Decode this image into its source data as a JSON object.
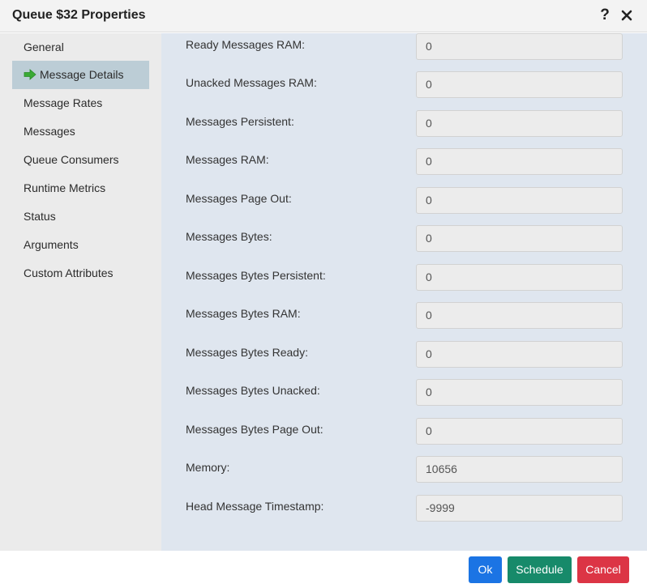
{
  "window": {
    "title": "Queue $32 Properties",
    "help_icon": "help-icon",
    "close_icon": "close-icon"
  },
  "sidebar": {
    "items": [
      {
        "label": "General",
        "active": false
      },
      {
        "label": "Message Details",
        "active": true,
        "icon": "arrow-right-icon"
      },
      {
        "label": "Message Rates",
        "active": false
      },
      {
        "label": "Messages",
        "active": false
      },
      {
        "label": "Queue Consumers",
        "active": false
      },
      {
        "label": "Runtime Metrics",
        "active": false
      },
      {
        "label": "Status",
        "active": false
      },
      {
        "label": "Arguments",
        "active": false
      },
      {
        "label": "Custom Attributes",
        "active": false
      }
    ]
  },
  "fields": [
    {
      "label": "Ready Messages RAM:",
      "value": "0"
    },
    {
      "label": "Unacked Messages RAM:",
      "value": "0"
    },
    {
      "label": "Messages Persistent:",
      "value": "0"
    },
    {
      "label": "Messages RAM:",
      "value": "0"
    },
    {
      "label": "Messages Page Out:",
      "value": "0"
    },
    {
      "label": "Messages Bytes:",
      "value": "0"
    },
    {
      "label": "Messages Bytes Persistent:",
      "value": "0"
    },
    {
      "label": "Messages Bytes RAM:",
      "value": "0"
    },
    {
      "label": "Messages Bytes Ready:",
      "value": "0"
    },
    {
      "label": "Messages Bytes Unacked:",
      "value": "0"
    },
    {
      "label": "Messages Bytes Page Out:",
      "value": "0"
    },
    {
      "label": "Memory:",
      "value": "10656"
    },
    {
      "label": "Head Message Timestamp:",
      "value": "-9999"
    }
  ],
  "footer": {
    "ok_label": "Ok",
    "schedule_label": "Schedule",
    "cancel_label": "Cancel"
  },
  "colors": {
    "ok": "#1b74e4",
    "schedule": "#178a6a",
    "cancel": "#dc3545",
    "active_nav": "#bccdd6",
    "content_bg": "#dfe6ef",
    "arrow": "#3aaa35"
  }
}
